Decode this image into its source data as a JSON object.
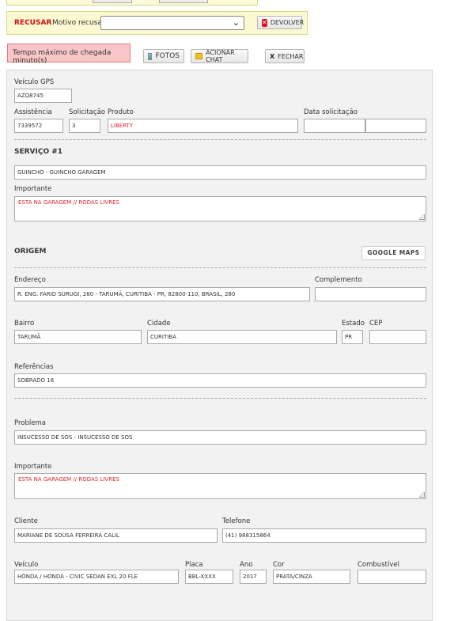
{
  "refusal": {
    "title": "RECUSAR",
    "motivo_label": "Motivo recusa:",
    "motivo_value": "",
    "devolver_label": "DEVOLVER"
  },
  "alert": "Tempo máximo de chegada minuto(s)",
  "toolbar": {
    "fotos_label": "FOTOS",
    "chat_label": "ACIONAR CHAT",
    "fechar_label": "FECHAR"
  },
  "form": {
    "veiculo_gps_label": "Veículo GPS",
    "veiculo_gps": "AZQ8745",
    "assistencia_label": "Assistência",
    "assistencia": "7339572",
    "solicitacao_label": "Solicitação",
    "solicitacao": "3",
    "produto_label": "Produto",
    "produto": "LIBERTY",
    "data_solicitacao_label": "Data solicitação",
    "data_solicitacao_1": "",
    "data_solicitacao_2": ""
  },
  "servico": {
    "title": "SERVIÇO #1",
    "tipo": "GUINCHO - GUINCHO GARAGEM",
    "importante_label": "Importante",
    "importante": "ESTA NA GARAGEM  // RODAS LIVRES"
  },
  "origem": {
    "title": "ORIGEM",
    "google_maps_label": "GOOGLE MAPS",
    "endereco_label": "Endereço",
    "endereco": "R. ENG. FARID SURUGI, 280 - TARUMÃ, CURITIBA - PR, 82800-110, BRASIL, 280",
    "complemento_label": "Complemento",
    "complemento": "",
    "bairro_label": "Bairro",
    "bairro": "TARUMÃ",
    "cidade_label": "Cidade",
    "cidade": "CURITIBA",
    "estado_label": "Estado",
    "estado": "PR",
    "cep_label": "CEP",
    "cep": "",
    "referencias_label": "Referências",
    "referencias": "SOBRADO 16"
  },
  "detalhes": {
    "problema_label": "Problema",
    "problema": "INSUCESSO DE SOS - INSUCESSO DE SOS",
    "importante_label": "Importante",
    "importante": "ESTA NA GARAGEM  // RODAS LIVRES",
    "cliente_label": "Cliente",
    "cliente": "MARIANE DE SOUSA FERREIRA CALIL",
    "telefone_label": "Telefone",
    "telefone": "(41) 988315864",
    "veiculo_label": "Veículo",
    "veiculo": "HONDA / HONDA - CIVIC SEDAN EXL 20 FLE",
    "placa_label": "Placa",
    "placa": "BBL-XXXX",
    "ano_label": "Ano",
    "ano": "2017",
    "cor_label": "Cor",
    "cor": "PRATA/CINZA",
    "combustivel_label": "Combustível",
    "combustivel": ""
  }
}
